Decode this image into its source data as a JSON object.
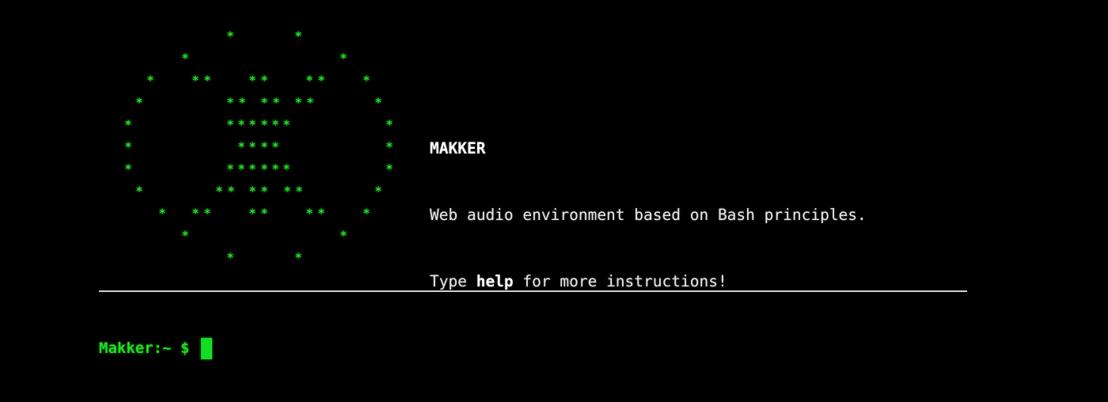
{
  "terminal": {
    "logo_glyph": "*",
    "title": "MAKKER",
    "description": "Web audio environment based on Bash principles.",
    "help_prefix": "Type ",
    "help_command": "help",
    "help_suffix": " for more instructions!",
    "prompt": "Makker:~ $",
    "colors": {
      "background": "#000000",
      "accent_green": "#22dd22",
      "text": "#e6e6e6",
      "divider": "#cfcfcf"
    }
  }
}
